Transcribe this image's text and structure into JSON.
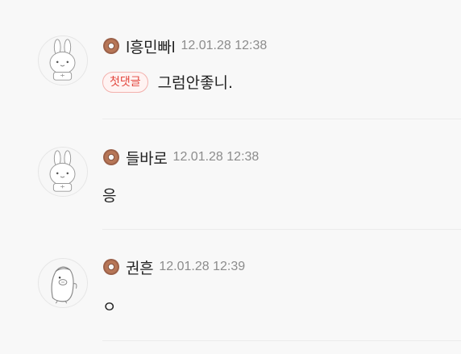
{
  "comments": [
    {
      "nickname": "l흥민빠l",
      "date": "12.01.28 12:38",
      "first_tag": "첫댓글",
      "text": "그럼안좋니.",
      "avatar": "rabbit-avatar",
      "badge": "donut-icon"
    },
    {
      "nickname": "들바로",
      "date": "12.01.28 12:38",
      "text": "응",
      "avatar": "rabbit-avatar",
      "badge": "donut-icon"
    },
    {
      "nickname": "권흔",
      "date": "12.01.28 12:39",
      "text": "ㅇ",
      "avatar": "penguin-avatar",
      "badge": "donut-icon"
    }
  ],
  "colors": {
    "background": "#f8f8f8",
    "date_text": "#8c8c8c",
    "first_tag_text": "#e2463d",
    "first_tag_border": "#f3b1ad",
    "donut": "#8a5a44"
  }
}
